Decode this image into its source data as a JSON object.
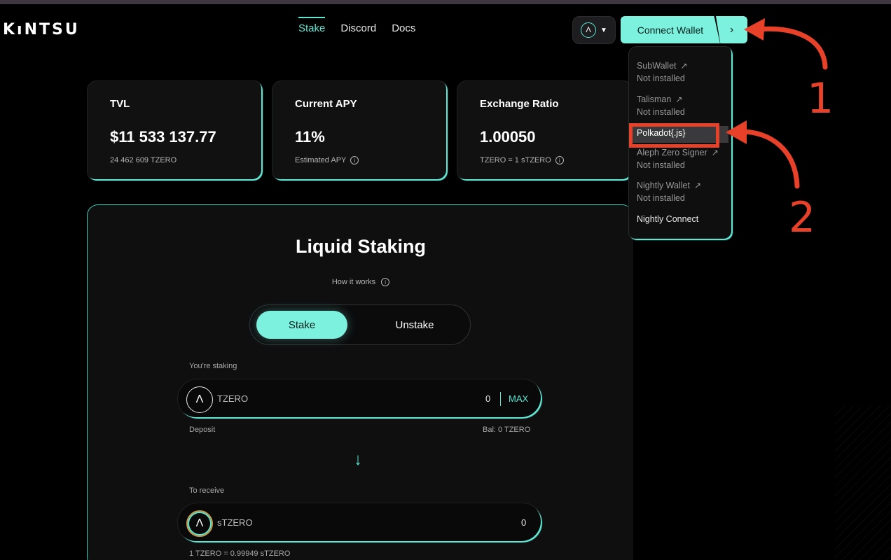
{
  "header": {
    "logo": "KıNTSU",
    "nav": [
      {
        "label": "Stake"
      },
      {
        "label": "Discord"
      },
      {
        "label": "Docs"
      }
    ],
    "network_glyph": "Λ",
    "connect_label": "Connect Wallet",
    "expand_glyph": "›"
  },
  "stats": [
    {
      "title": "TVL",
      "value": "$11 533 137.77",
      "sub": "24 462 609 TZERO"
    },
    {
      "title": "Current APY",
      "value": "11%",
      "sub": "Estimated APY"
    },
    {
      "title": "Exchange Ratio",
      "value": "1.00050",
      "sub": "TZERO = 1 sTZERO"
    }
  ],
  "staking": {
    "title": "Liquid Staking",
    "how_it_works": "How it works",
    "tab_stake": "Stake",
    "tab_unstake": "Unstake",
    "staking_label": "You're staking",
    "from_token": "TZERO",
    "from_amount": "0",
    "max_label": "MAX",
    "deposit_label": "Deposit",
    "balance": "Bal: 0 TZERO",
    "arrow": "↓",
    "receive_label": "To receive",
    "to_token": "sTZERO",
    "to_amount": "0",
    "rate": "1 TZERO = 0.99949 sTZERO"
  },
  "wallets": [
    {
      "name": "SubWallet",
      "status": "Not installed"
    },
    {
      "name": "Talisman",
      "status": "Not installed"
    },
    {
      "name": "Polkadot{.js}"
    },
    {
      "name": "Aleph Zero Signer",
      "status": "Not installed"
    },
    {
      "name": "Nightly Wallet",
      "status": "Not installed"
    },
    {
      "name": "Nightly Connect"
    }
  ],
  "annotations": {
    "step1": "1",
    "step2": "2",
    "color": "#e8412a"
  },
  "colors": {
    "accent": "#7cf1de",
    "background": "#000000"
  }
}
